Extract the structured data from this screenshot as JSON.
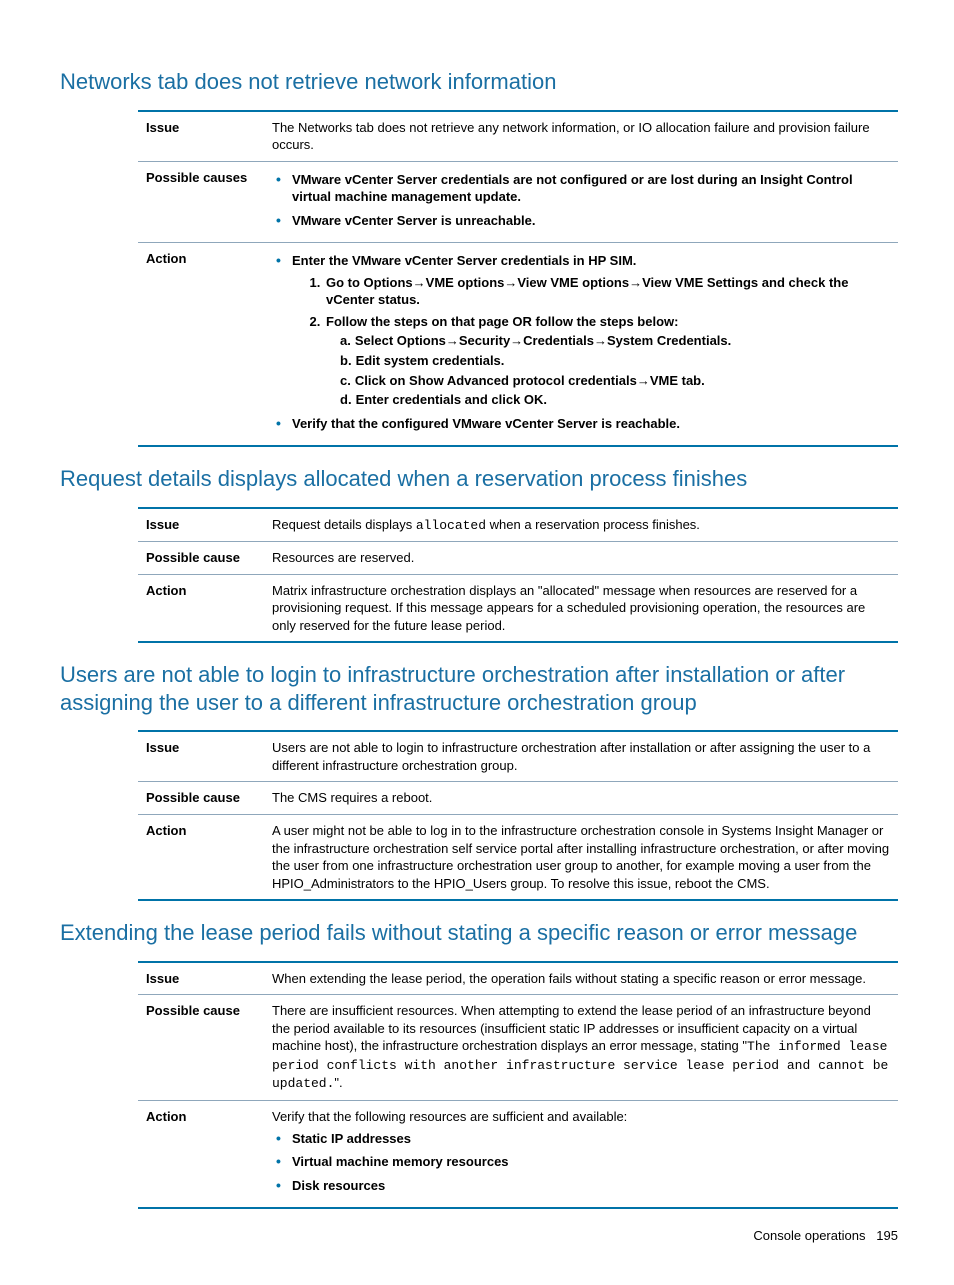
{
  "sections": [
    {
      "heading": "Networks tab does not retrieve network information",
      "issue_label": "Issue",
      "issue": "The Networks tab does not retrieve any network information, or IO allocation failure and provision failure occurs.",
      "cause_label": "Possible causes",
      "causes_bullets": [
        "VMware vCenter Server credentials are not configured or are lost during an Insight Control virtual machine management update.",
        "VMware vCenter Server is unreachable."
      ],
      "action_label": "Action",
      "action_bullet1": "Enter the VMware vCenter Server credentials in HP SIM.",
      "step1_pre": "Go to ",
      "step1_path": "Options→VME options→View VME options→View VME Settings",
      "step1_post": " and check the vCenter status.",
      "step2": "Follow the steps on that page OR follow the steps below:",
      "sub_a_pre": "Select ",
      "sub_a_path": "Options→Security→Credentials→System Credentials",
      "sub_a_post": ".",
      "sub_b": "Edit system credentials.",
      "sub_c_pre": "Click on ",
      "sub_c_bold1": "Show Advanced protocol credentials",
      "sub_c_mid": "→",
      "sub_c_bold2": "VME tab",
      "sub_c_post": ".",
      "sub_d_pre": "Enter credentials and click ",
      "sub_d_bold": "OK",
      "sub_d_post": ".",
      "action_bullet2": "Verify that the configured VMware vCenter Server is reachable."
    },
    {
      "heading": "Request details displays allocated when a reservation process finishes",
      "issue_label": "Issue",
      "issue_pre": "Request details displays ",
      "issue_code": "allocated",
      "issue_post": " when a reservation process finishes.",
      "cause_label": "Possible cause",
      "cause": "Resources are reserved.",
      "action_label": "Action",
      "action": "Matrix infrastructure orchestration displays an \"allocated\" message when resources are reserved for a provisioning request. If this message appears for a scheduled provisioning operation, the resources are only reserved for the future lease period."
    },
    {
      "heading": "Users are not able to login to infrastructure orchestration after installation or after assigning the user to a different infrastructure orchestration group",
      "issue_label": "Issue",
      "issue": "Users are not able to login to infrastructure orchestration after installation or after assigning the user to a different infrastructure orchestration group.",
      "cause_label": "Possible cause",
      "cause": "The CMS requires a reboot.",
      "action_label": "Action",
      "action": "A user might not be able to log in to the infrastructure orchestration console in Systems Insight Manager or the infrastructure orchestration self service portal after installing infrastructure orchestration, or after moving the user from one infrastructure orchestration user group to another, for example moving a user from the HPIO_Administrators to the HPIO_Users group. To resolve this issue, reboot the CMS."
    },
    {
      "heading": "Extending the lease period fails without stating a specific reason or error message",
      "issue_label": "Issue",
      "issue": "When extending the lease period, the operation fails without stating a specific reason or error message.",
      "cause_label": "Possible cause",
      "cause_pre": "There are insufficient resources. When attempting to extend the lease period of an infrastructure beyond the period available to its resources (insufficient static IP addresses or insufficient capacity on a virtual machine host), the infrastructure orchestration displays an error message, stating \"",
      "cause_code": "The informed lease period conflicts with another infrastructure service lease period and cannot be updated.",
      "cause_post": "\".",
      "action_label": "Action",
      "action_pre": "Verify that the following resources are sufficient and available:",
      "action_bullets": [
        "Static IP addresses",
        "Virtual machine memory resources",
        "Disk resources"
      ]
    }
  ],
  "footer": {
    "section": "Console operations",
    "page": "195"
  },
  "chart_data": {
    "type": "table",
    "note": "Document page — no quantitative chart present."
  }
}
